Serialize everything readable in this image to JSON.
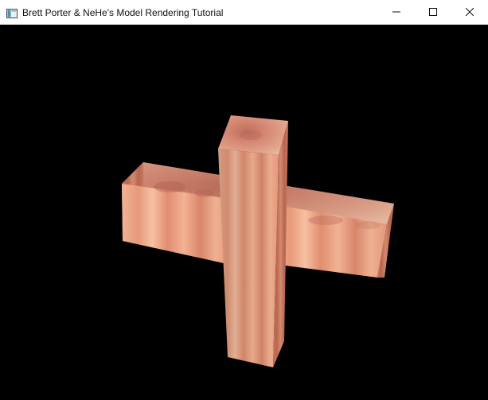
{
  "window": {
    "title": "Brett Porter & NeHe's Model Rendering Tutorial",
    "controls": [
      "minimize",
      "maximize",
      "close"
    ]
  },
  "icons": {
    "app": "app-window-icon",
    "minimize": "minimize-icon",
    "maximize": "maximize-icon",
    "close": "close-icon"
  },
  "scene": {
    "background": "#000000",
    "model": "cross",
    "colors": {
      "light": "#f3b99a",
      "mid": "#e48e70",
      "dark": "#b86c55",
      "shadow": "#8f4c3d"
    }
  }
}
